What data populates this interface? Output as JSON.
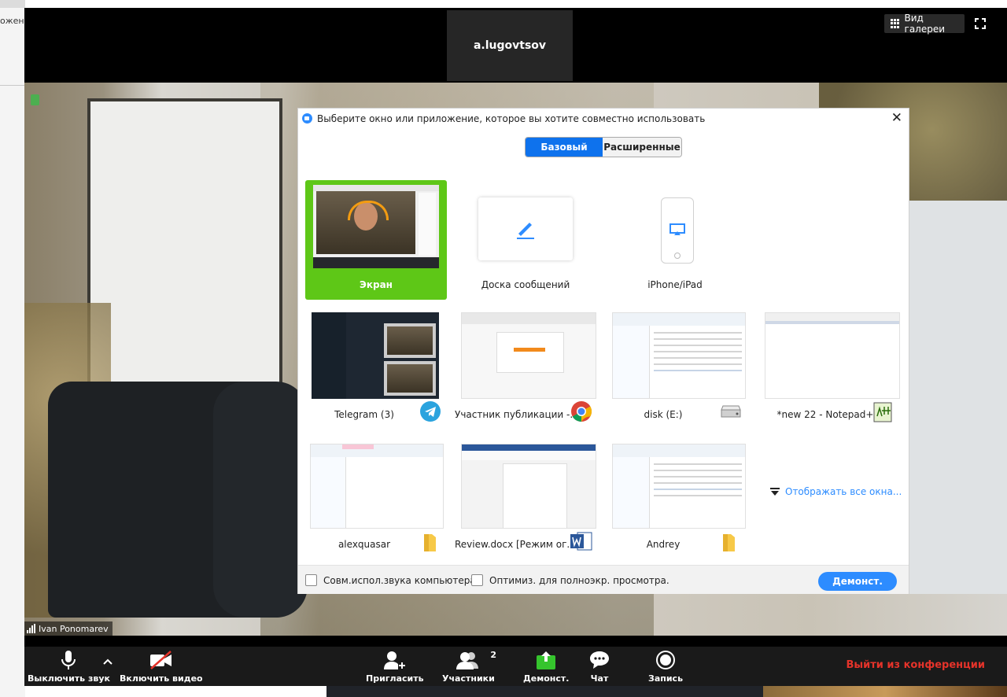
{
  "background_window": {
    "fragment": "ожени"
  },
  "meeting": {
    "top_participant": "a.lugovtsov",
    "gallery_button": "Вид галереи",
    "main_participant": "Ivan Ponomarev"
  },
  "dialog": {
    "title": "Выберите окно или приложение, которое вы хотите совместно использовать",
    "tabs": {
      "basic": "Базовый",
      "advanced": "Расширенные"
    },
    "row1": [
      {
        "label": "Экран",
        "icon": "monitor-screen",
        "selected": true
      },
      {
        "label": "Доска сообщений",
        "icon": "pen-icon"
      },
      {
        "label": "iPhone/iPad",
        "icon": "airplay-icon"
      }
    ],
    "row2": [
      {
        "label": "Telegram (3)",
        "icon": "telegram-icon"
      },
      {
        "label": "Участник публикации -...",
        "icon": "chrome-icon"
      },
      {
        "label": "disk (E:)",
        "icon": "drive-icon"
      },
      {
        "label": "*new 22 - Notepad++",
        "icon": "notepadpp-icon"
      }
    ],
    "row3": [
      {
        "label": "alexquasar",
        "icon": "folder-icon"
      },
      {
        "label": "Review.docx [Режим ог...",
        "icon": "word-icon"
      },
      {
        "label": "Andrey",
        "icon": "folder-icon"
      }
    ],
    "show_all": "Отображать все окна...",
    "footer": {
      "share_sound": "Совм.испол.звука компьютера",
      "optimize": "Оптимиз. для полноэкр. просмотра.",
      "share_button": "Демонст."
    }
  },
  "toolbar": {
    "mute": "Выключить звук",
    "video": "Включить видео",
    "invite": "Пригласить",
    "participants": "Участники",
    "participants_count": "2",
    "share": "Демонст.",
    "chat": "Чат",
    "record": "Запись",
    "leave": "Выйти из конференции"
  },
  "colors": {
    "accent_blue": "#2d8cff",
    "tab_blue": "#0e72ed",
    "selected_green": "#5ec717",
    "leave_red": "#e5332a",
    "share_green": "#35c42d"
  }
}
